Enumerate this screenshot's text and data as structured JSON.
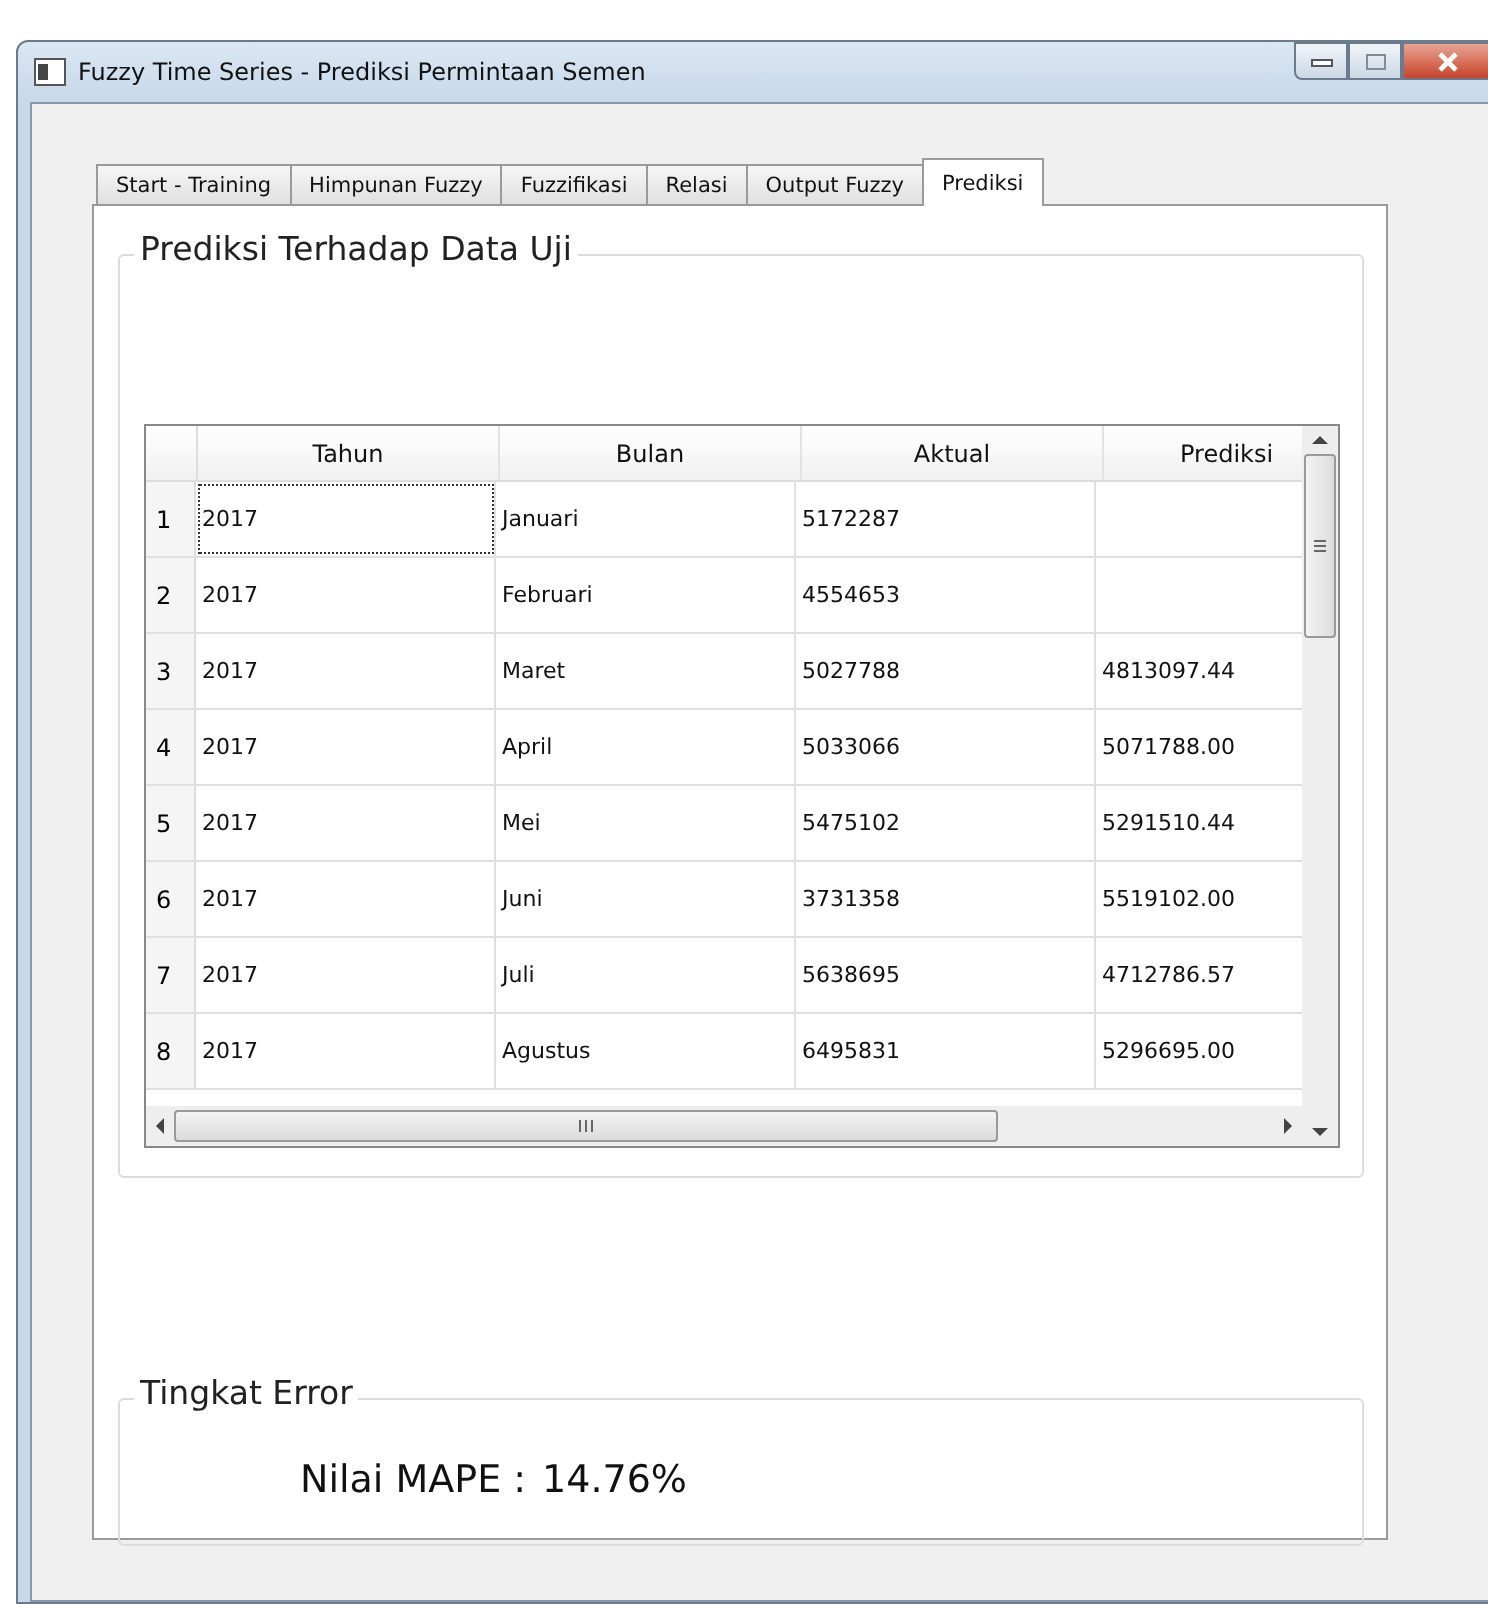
{
  "window": {
    "title": "Fuzzy Time Series - Prediksi Permintaan Semen"
  },
  "tabs": [
    {
      "label": "Start - Training",
      "selected": false
    },
    {
      "label": "Himpunan Fuzzy",
      "selected": false
    },
    {
      "label": "Fuzzifikasi",
      "selected": false
    },
    {
      "label": "Relasi",
      "selected": false
    },
    {
      "label": "Output Fuzzy",
      "selected": false
    },
    {
      "label": "Prediksi",
      "selected": true
    }
  ],
  "prediction_group": {
    "title": "Prediksi Terhadap Data Uji",
    "table": {
      "columns": [
        "Tahun",
        "Bulan",
        "Aktual",
        "Prediksi"
      ],
      "rows": [
        {
          "number": "1",
          "cells": [
            "2017",
            "Januari",
            "5172287",
            ""
          ],
          "focused": true
        },
        {
          "number": "2",
          "cells": [
            "2017",
            "Februari",
            "4554653",
            ""
          ],
          "focused": false
        },
        {
          "number": "3",
          "cells": [
            "2017",
            "Maret",
            "5027788",
            "4813097.44"
          ],
          "focused": false
        },
        {
          "number": "4",
          "cells": [
            "2017",
            "April",
            "5033066",
            "5071788.00"
          ],
          "focused": false
        },
        {
          "number": "5",
          "cells": [
            "2017",
            "Mei",
            "5475102",
            "5291510.44"
          ],
          "focused": false
        },
        {
          "number": "6",
          "cells": [
            "2017",
            "Juni",
            "3731358",
            "5519102.00"
          ],
          "focused": false
        },
        {
          "number": "7",
          "cells": [
            "2017",
            "Juli",
            "5638695",
            "4712786.57"
          ],
          "focused": false
        },
        {
          "number": "8",
          "cells": [
            "2017",
            "Agustus",
            "6495831",
            "5296695.00"
          ],
          "focused": false
        }
      ]
    }
  },
  "error_group": {
    "title": "Tingkat Error",
    "label": "Nilai MAPE :",
    "value": "14.76%"
  }
}
